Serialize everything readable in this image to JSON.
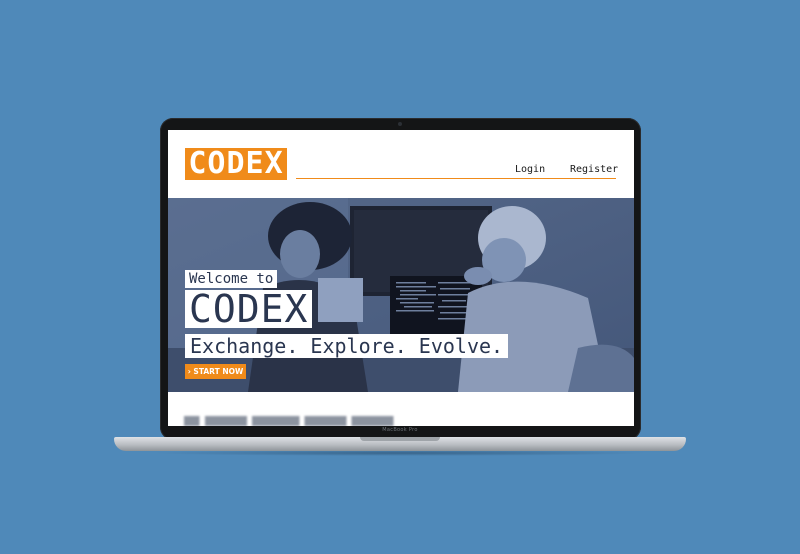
{
  "colors": {
    "background": "#4f89b9",
    "brand_orange": "#f08b1a",
    "hero_tint": "#4d6180",
    "text_dark": "#2a3650"
  },
  "header": {
    "logo_text": "CODEX",
    "nav": {
      "login": "Login",
      "register": "Register"
    }
  },
  "hero": {
    "welcome": "Welcome to",
    "title": "CODEX",
    "tagline": "Exchange. Explore. Evolve.",
    "start_button": "› START NOW"
  },
  "laptop": {
    "label": "MacBook Pro"
  },
  "icons": [
    "laptop-device",
    "camera-icon"
  ]
}
